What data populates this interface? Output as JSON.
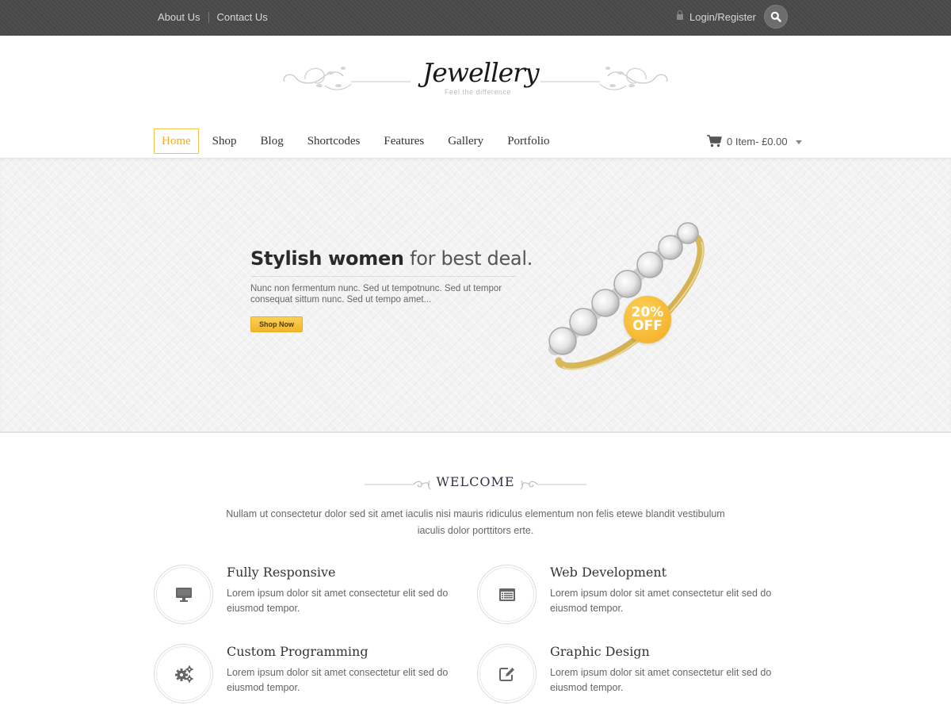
{
  "topbar": {
    "links": [
      "About Us",
      "Contact Us"
    ],
    "login_label": "Login/Register",
    "lock_icon": "lock-icon",
    "search_icon": "search-icon"
  },
  "logo": {
    "title": "Jewellery",
    "tagline": "Feel the difference"
  },
  "nav": {
    "items": [
      "Home",
      "Shop",
      "Blog",
      "Shortcodes",
      "Features",
      "Gallery",
      "Portfolio"
    ],
    "active": "Home",
    "accent_color": "#f6c14e"
  },
  "cart": {
    "icon": "cart-icon",
    "label": "0 Item- £0.00"
  },
  "hero": {
    "headline_bold": "Stylish women",
    "headline_light": "for best deal.",
    "text": "Nunc non fermentum nunc. Sed ut tempotnunc. Sed ut tempor consequat sittum nunc. Sed ut tempo amet...",
    "button_label": "Shop Now",
    "badge_line1": "20%",
    "badge_line2": "OFF",
    "button_color": "#f6c14e"
  },
  "welcome": {
    "heading": "WELCOME",
    "text": "Nullam ut consectetur dolor sed sit amet iaculis nisi mauris ridiculus elementum non felis etewe blandit vestibulum iaculis dolor porttitors erte."
  },
  "features": [
    {
      "icon": "monitor-icon",
      "title": "Fully Responsive",
      "text": "Lorem ipsum dolor sit amet consectetur elit sed do eiusmod tempor."
    },
    {
      "icon": "browser-list-icon",
      "title": "Web Development",
      "text": "Lorem ipsum dolor sit amet consectetur elit sed do eiusmod tempor."
    },
    {
      "icon": "gears-icon",
      "title": "Custom Programming",
      "text": "Lorem ipsum dolor sit amet consectetur elit sed do eiusmod tempor."
    },
    {
      "icon": "edit-icon",
      "title": "Graphic Design",
      "text": "Lorem ipsum dolor sit amet consectetur elit sed do eiusmod tempor."
    }
  ]
}
